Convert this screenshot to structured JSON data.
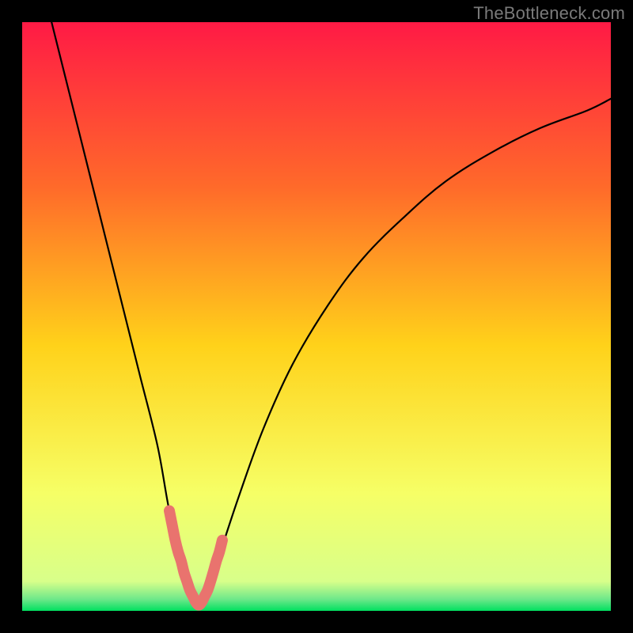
{
  "watermark": "TheBottleneck.com",
  "colors": {
    "frame": "#000000",
    "gradient_top": "#ff1a45",
    "gradient_mid_upper": "#ff6a2a",
    "gradient_mid": "#ffd21a",
    "gradient_lower": "#f6ff66",
    "gradient_green": "#00e060",
    "curve": "#000000",
    "marker": "#e9736e"
  },
  "chart_data": {
    "type": "line",
    "title": "",
    "xlabel": "",
    "ylabel": "",
    "xlim": [
      0,
      100
    ],
    "ylim": [
      0,
      100
    ],
    "grid": false,
    "legend": null,
    "series": [
      {
        "name": "bottleneck-curve",
        "x": [
          5,
          8,
          11,
          14,
          17,
          20,
          23,
          25,
          27,
          28,
          29,
          30,
          31,
          32,
          34,
          37,
          41,
          46,
          52,
          58,
          65,
          72,
          80,
          88,
          96,
          100
        ],
        "y": [
          100,
          88,
          76,
          64,
          52,
          40,
          28,
          17,
          9,
          5,
          2,
          1,
          2,
          5,
          11,
          20,
          31,
          42,
          52,
          60,
          67,
          73,
          78,
          82,
          85,
          87
        ]
      }
    ],
    "markers": {
      "name": "valley-highlight",
      "x": [
        25.0,
        25.5,
        26.0,
        26.5,
        27.0,
        27.5,
        28.0,
        28.5,
        29.0,
        29.5,
        30.0,
        30.5,
        31.0,
        31.5,
        32.0,
        32.5,
        33.0,
        33.5,
        34.0
      ],
      "y": [
        17,
        14.5,
        12,
        10,
        8.5,
        6.5,
        5,
        3.5,
        2.5,
        1.5,
        1,
        1.5,
        2.5,
        3.5,
        5,
        6.7,
        8.5,
        10,
        12
      ]
    }
  }
}
